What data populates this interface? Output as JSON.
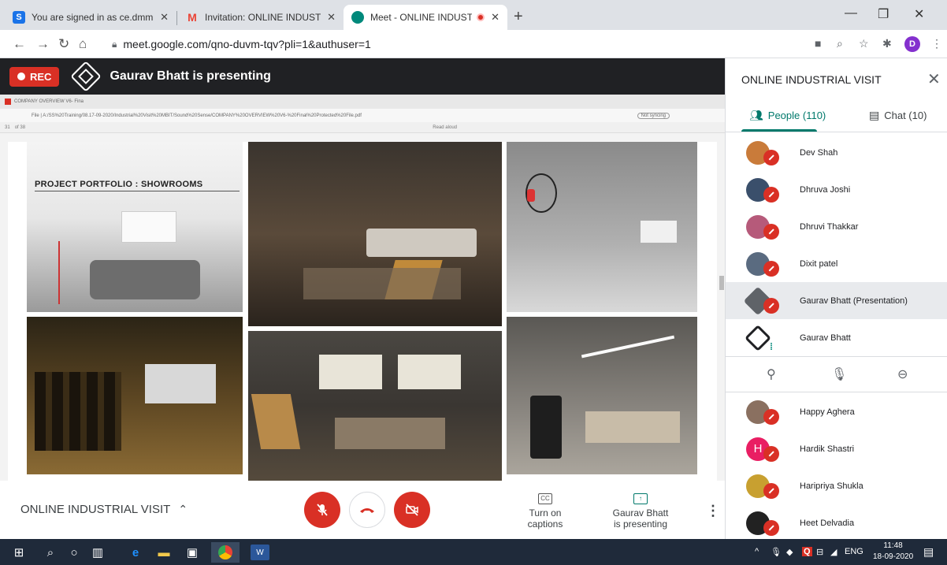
{
  "browser": {
    "tabs": [
      {
        "title": "You are signed in as ce.dmm",
        "favicon_letter": "S",
        "favicon_color": "#1a73e8",
        "active": false
      },
      {
        "title": "Invitation: ONLINE INDUSTRIAL \\",
        "favicon_letter": "M",
        "favicon_color": "#ea4335",
        "active": false
      },
      {
        "title": "Meet - ONLINE INDUSTRIAL",
        "favicon_letter": "",
        "favicon_color": "#00897b",
        "active": true
      }
    ],
    "new_tab_label": "+",
    "url": "meet.google.com/qno-duvm-tqv?pli=1&authuser=1",
    "profile_letter": "D"
  },
  "meet": {
    "rec_label": "REC",
    "presenting_banner": "Gaurav Bhatt is presenting",
    "shared_screen": {
      "edge_tab_title": "COMPANY OVERVIEW V6- Fina",
      "edge_url": "File | A:/SS%20Training/08.17-09-2020/Industrial%20Visit%20MBIT/Sound%20Sense/COMPANY%20OVERVIEW%20V6-%20Final%20Protected%20File.pdf",
      "edge_not_syncing": "Not syncing",
      "pdf_page": "31",
      "pdf_page_total": "of 38",
      "pdf_read_aloud": "Read aloud",
      "portfolio_title": "PROJECT PORTFOLIO : SHOWROOMS"
    },
    "meeting_name": "ONLINE INDUSTRIAL VISIT",
    "captions_label": "Turn on captions",
    "captions_icon": "CC",
    "presenting_label_line1": "Gaurav Bhatt",
    "presenting_label_line2": "is presenting"
  },
  "panel": {
    "title": "ONLINE INDUSTRIAL VISIT",
    "people_tab": "People (110)",
    "chat_tab": "Chat (10)",
    "people": [
      {
        "name": "Dev Shah",
        "avatar_color": "#c97b3a",
        "initial": ""
      },
      {
        "name": "Dhruva Joshi",
        "avatar_color": "#3a4f6b",
        "initial": ""
      },
      {
        "name": "Dhruvi Thakkar",
        "avatar_color": "#b65a7a",
        "initial": ""
      },
      {
        "name": "Dixit patel",
        "avatar_color": "#5a6b80",
        "initial": ""
      },
      {
        "name": "Gaurav Bhatt (Presentation)",
        "avatar_color": "#202124",
        "initial": ""
      },
      {
        "name": "Gaurav Bhatt",
        "avatar_color": "#202124",
        "initial": ""
      },
      {
        "name": "Happy Aghera",
        "avatar_color": "#8a7060",
        "initial": ""
      },
      {
        "name": "Hardik Shastri",
        "avatar_color": "#e91e63",
        "initial": "H"
      },
      {
        "name": "Haripriya Shukla",
        "avatar_color": "#c8a030",
        "initial": ""
      },
      {
        "name": "Heet Delvadia",
        "avatar_color": "#222222",
        "initial": ""
      }
    ]
  },
  "taskbar": {
    "language": "ENG",
    "time": "11:48",
    "date": "18-09-2020"
  },
  "colors": {
    "meet_red": "#d93025",
    "meet_teal": "#00796b",
    "taskbar_bg": "#1f2a3a"
  }
}
